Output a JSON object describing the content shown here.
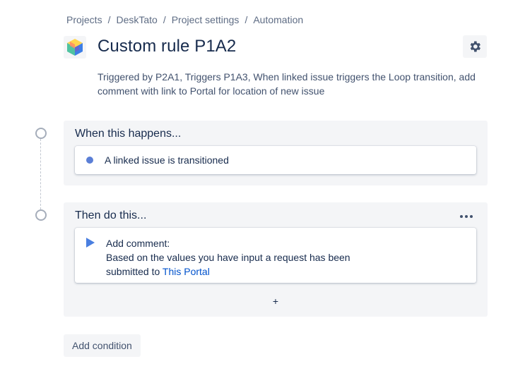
{
  "breadcrumb": [
    {
      "label": "Projects"
    },
    {
      "label": "DeskTato"
    },
    {
      "label": "Project settings"
    },
    {
      "label": "Automation"
    }
  ],
  "breadcrumb_separator": "/",
  "header": {
    "title": "Custom rule P1A2",
    "settings_icon": "gear-icon",
    "project_icon": "cube-icon"
  },
  "description": "Triggered by P2A1, Triggers P1A3, When linked issue triggers the Loop transition, add comment with link to Portal for location of new issue",
  "trigger_section": {
    "title": "When this happens...",
    "trigger_label": "A linked issue is transitioned"
  },
  "action_section": {
    "title": "Then do this...",
    "action_title": "Add comment:",
    "action_body": "Based on the values you have input a request has been",
    "action_body_line2": "submitted to",
    "action_link": "This Portal",
    "add_label": "+"
  },
  "add_condition_label": "Add condition",
  "colors": {
    "accent": "#0052cc",
    "trigger_dot": "#5b7fd6",
    "play": "#4a7fe0",
    "panel_bg": "#f4f5f7"
  }
}
